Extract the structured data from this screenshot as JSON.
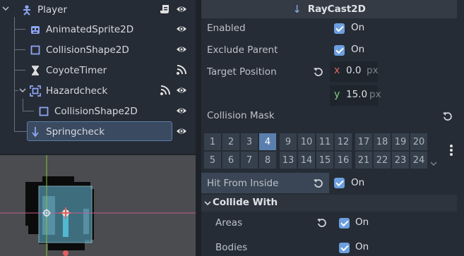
{
  "scene_tree": {
    "nodes": [
      {
        "label": "Player",
        "icon": "character-body-icon"
      },
      {
        "label": "AnimatedSprite2D",
        "icon": "animated-sprite-icon"
      },
      {
        "label": "CollisionShape2D",
        "icon": "collision-shape-icon"
      },
      {
        "label": "CoyoteTimer",
        "icon": "timer-icon"
      },
      {
        "label": "Hazardcheck",
        "icon": "area2d-icon"
      },
      {
        "label": "CollisionShape2D",
        "icon": "collision-shape-icon"
      },
      {
        "label": "Springcheck",
        "icon": "raycast-icon"
      }
    ]
  },
  "inspector": {
    "node_type": "RayCast2D",
    "enabled": {
      "label": "Enabled",
      "value": "On"
    },
    "exclude_parent": {
      "label": "Exclude Parent",
      "value": "On"
    },
    "target_position": {
      "label": "Target Position",
      "x_axis": "x",
      "x_value": "0.0",
      "x_unit": "px",
      "y_axis": "y",
      "y_value": "15.0",
      "y_unit": "px"
    },
    "collision_mask": {
      "label": "Collision Mask",
      "layers": [
        "1",
        "2",
        "3",
        "4",
        "9",
        "10",
        "11",
        "12",
        "17",
        "18",
        "19",
        "20",
        "5",
        "6",
        "7",
        "8",
        "13",
        "14",
        "15",
        "16",
        "21",
        "22",
        "23",
        "24"
      ],
      "enabled_layers": [
        "4"
      ]
    },
    "hit_from_inside": {
      "label": "Hit From Inside",
      "value": "On"
    },
    "collide_with": {
      "label": "Collide With",
      "areas": {
        "label": "Areas",
        "value": "On"
      },
      "bodies": {
        "label": "Bodies",
        "value": "On"
      }
    }
  },
  "colors": {
    "accent": "#6c9fe0",
    "selected_bg": "#3a4a60",
    "panel_bg": "#262c35",
    "x_axis": "#e0695e",
    "y_axis": "#7fd07a"
  }
}
